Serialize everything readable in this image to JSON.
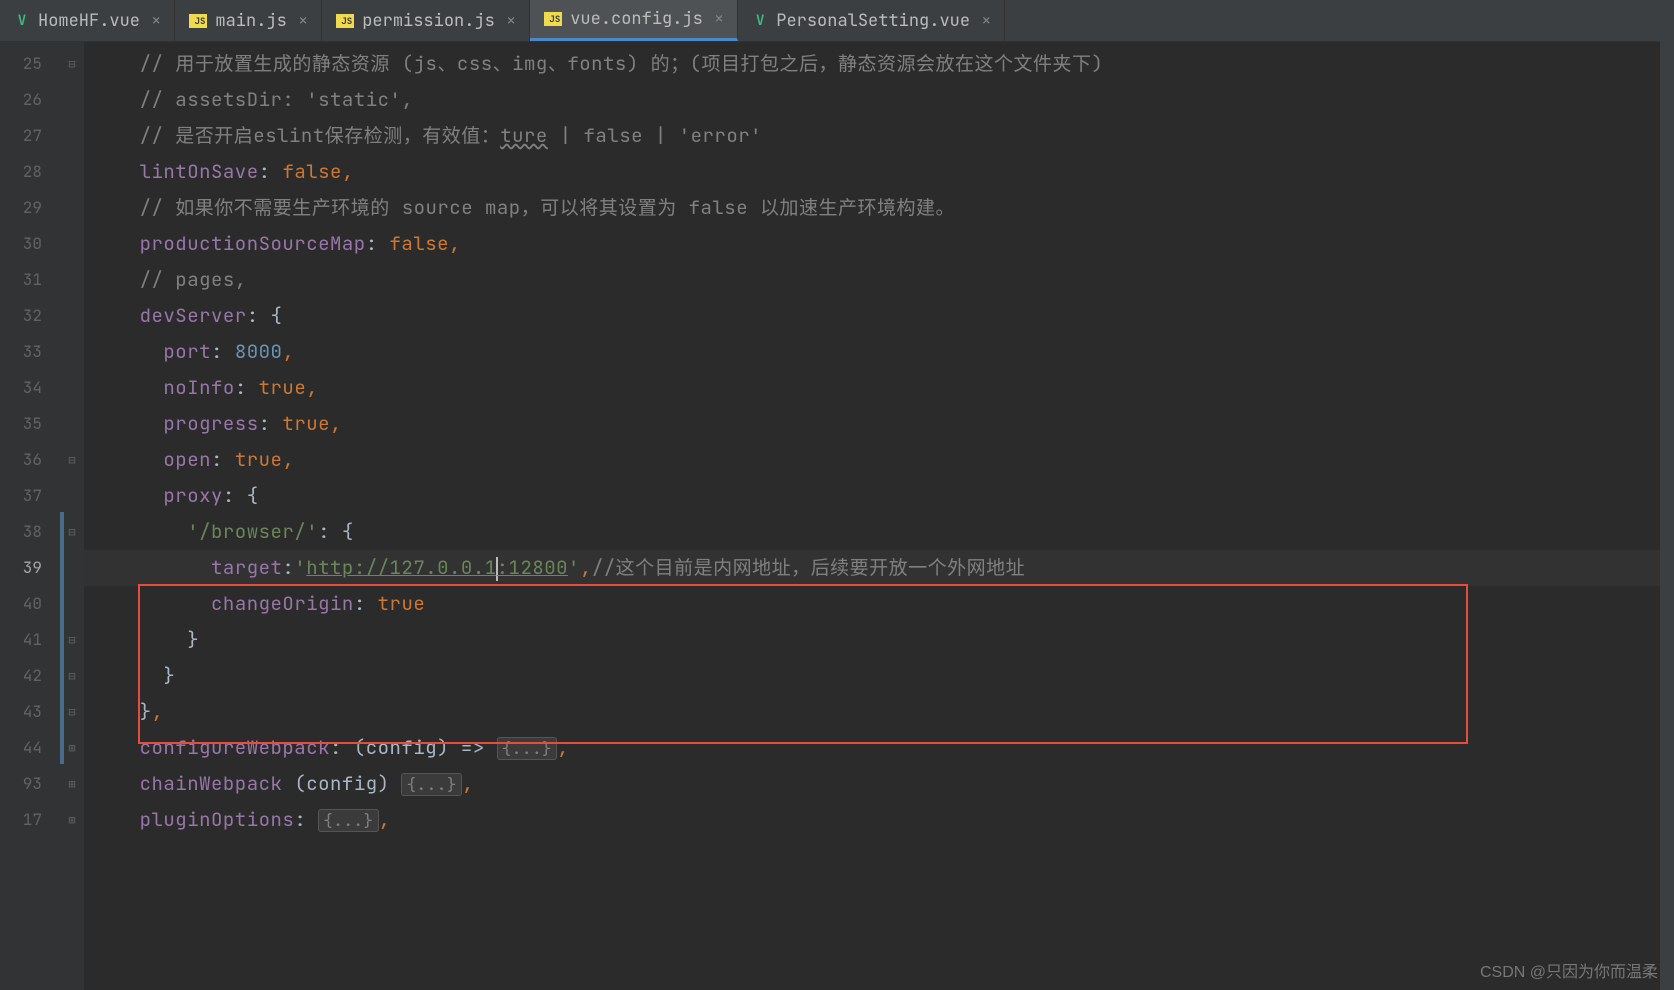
{
  "tabs": [
    {
      "icon": "vue",
      "label": "HomeHF.vue",
      "active": false
    },
    {
      "icon": "js",
      "label": "main.js",
      "active": false
    },
    {
      "icon": "js",
      "label": "permission.js",
      "active": false
    },
    {
      "icon": "js",
      "label": "vue.config.js",
      "active": true
    },
    {
      "icon": "vue",
      "label": "PersonalSetting.vue",
      "active": false
    }
  ],
  "line_numbers": [
    "25",
    "26",
    "27",
    "28",
    "29",
    "30",
    "31",
    "32",
    "33",
    "34",
    "35",
    "36",
    "37",
    "38",
    "39",
    "40",
    "41",
    "42",
    "43",
    "44",
    "93",
    "17"
  ],
  "current_line_index": 14,
  "fold_markers": {
    "0": "⊟",
    "11": "⊟",
    "13": "⊟",
    "16": "⊟",
    "17": "⊟",
    "18": "⊟",
    "19": "⊞",
    "20": "⊞",
    "21": "⊞"
  },
  "code": {
    "l25_comment_prefix": "// ",
    "l25_cn": "用于放置生成的静态资源 (js、css、img、fonts) 的；(项目打包之后，静态资源会放在这个文件夹下)",
    "l26": "// assetsDir: 'static',",
    "l27_prefix": "// 是否开启eslint保存检测，有效值：",
    "l27_ture": "ture",
    "l27_rest": " | false | 'error'",
    "l28_key": "lintOnSave",
    "l28_val": "false",
    "l29": "// 如果你不需要生产环境的 source map，可以将其设置为 false 以加速生产环境构建。",
    "l30_key": "productionSourceMap",
    "l30_val": "false",
    "l31": "// pages,",
    "l32_key": "devServer",
    "l33_key": "port",
    "l33_val": "8000",
    "l34_key": "noInfo",
    "l34_val": "true",
    "l35_key": "progress",
    "l35_val": "true",
    "l36_key": "open",
    "l36_val": "true",
    "l37_key": "proxy",
    "l38_str": "'/browser/'",
    "l39_key": "target",
    "l39_url_a": "http://127.0.0.1",
    "l39_url_b": ":12800",
    "l39_comment": "//这个目前是内网地址，后续要开放一个外网地址",
    "l40_key": "changeOrigin",
    "l40_val": "true",
    "l44_key": "configureWebpack",
    "l44_param": "(config)",
    "l44_arrow": " => ",
    "l93_key": "chainWebpack",
    "l93_param": " (config) ",
    "l17_key": "pluginOptions",
    "fold_text": "{...}"
  },
  "watermark": "CSDN @只因为你而温柔"
}
